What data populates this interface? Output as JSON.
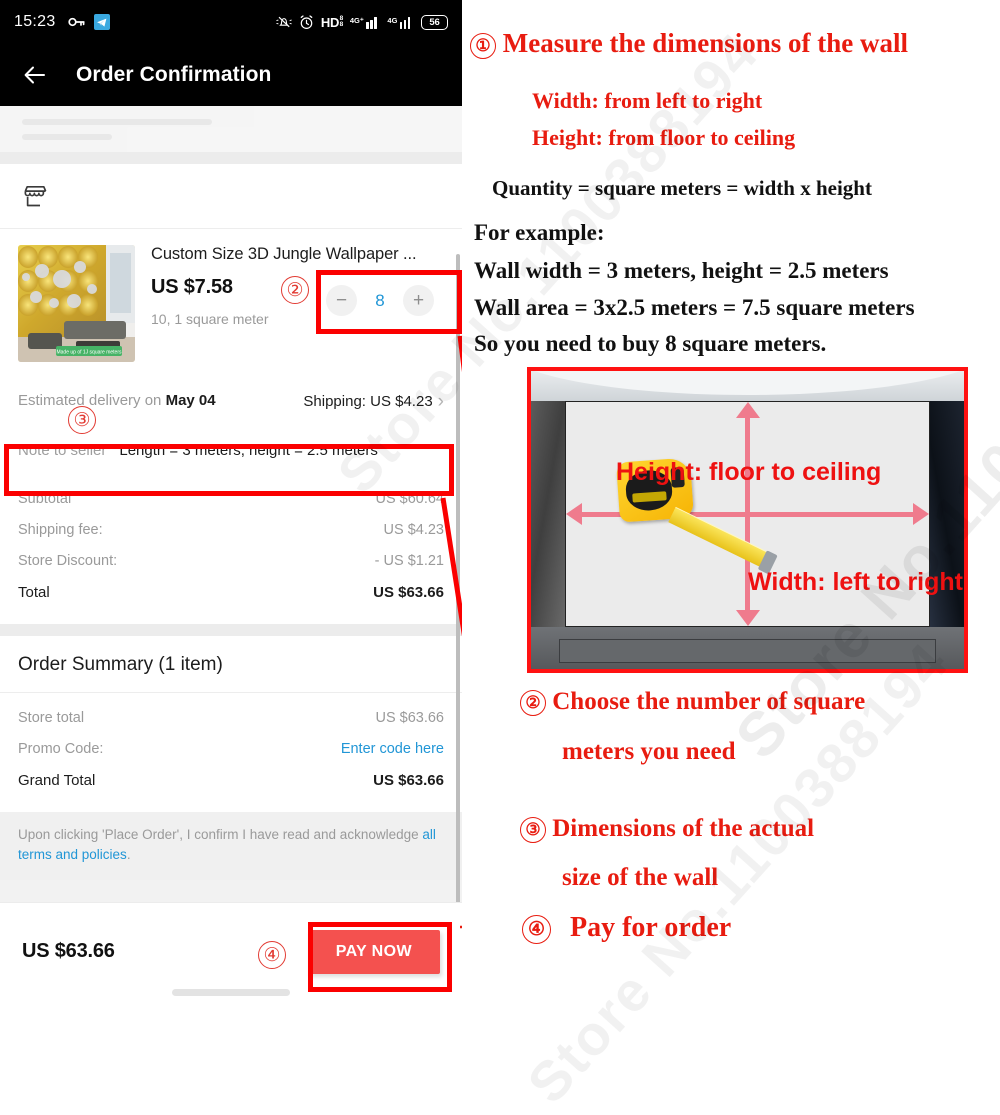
{
  "phone": {
    "statusbar": {
      "time": "15:23",
      "icons": [
        "key-icon",
        "telegram-icon",
        "silent-bell-icon",
        "alarm-clock-icon",
        "hd-icon",
        "signal-4g-plus-icon",
        "signal-4g-icon"
      ],
      "battery": "56"
    },
    "appbar": {
      "back_icon": "back-arrow-icon",
      "title": "Order Confirmation"
    },
    "store": {
      "icon": "storefront-icon",
      "name": ""
    },
    "product": {
      "title": "Custom Size 3D Jungle Wallpaper ...",
      "price": "US $7.58",
      "variant": "10, 1 square meter",
      "qty": "8",
      "minus": "−",
      "plus": "+",
      "thumb_badge": "Made up of 1J square meters"
    },
    "delivery": {
      "prefix": "Estimated delivery on ",
      "date": "May 04",
      "shipping_label": "Shipping: US $4.23",
      "chevron": "›"
    },
    "note": {
      "label": "Note to seller",
      "value": "Length = 3 meters, height = 2.5 meters"
    },
    "totals": [
      {
        "label": "Subtotal",
        "value": "US $60.64",
        "strong": false
      },
      {
        "label": "Shipping fee:",
        "value": "US $4.23",
        "strong": false
      },
      {
        "label": "Store Discount:",
        "value": "- US $1.21",
        "strong": false
      },
      {
        "label": "Total",
        "value": "US $63.66",
        "strong": true
      }
    ],
    "summary": {
      "heading": "Order Summary (1 item)",
      "rows": [
        {
          "label": "Store total",
          "value": "US $63.66",
          "strong": false,
          "link": false
        },
        {
          "label": "Promo Code:",
          "value": "Enter code here",
          "strong": false,
          "link": true
        },
        {
          "label": "Grand Total",
          "value": "US $63.66",
          "strong": true,
          "link": false
        }
      ]
    },
    "terms": {
      "text_before": "Upon clicking 'Place Order', I confirm I have read and acknowledge ",
      "link": "all terms and policies",
      "text_after": "."
    },
    "bottom": {
      "grand_total": "US $63.66",
      "pay_button": "PAY NOW"
    }
  },
  "annotations": {
    "markers": {
      "one": "①",
      "two": "②",
      "three": "③",
      "four": "④"
    },
    "step1": {
      "num": "①",
      "title": "Measure the dimensions of the wall",
      "line_width": "Width: from left to right",
      "line_height": "Height: from floor to ceiling"
    },
    "formula": "Quantity = square meters = width x height",
    "example": {
      "heading": "For example:",
      "l1": "Wall width = 3 meters, height = 2.5 meters",
      "l2": "Wall area = 3x2.5 meters = 7.5 square meters",
      "l3": "So you need to buy 8 square meters."
    },
    "wall_photo": {
      "height_label": "Height: floor to ceiling",
      "width_label": "Width: left to right"
    },
    "step2": {
      "num": "②",
      "l1": "Choose the number of square",
      "l2": "meters you need"
    },
    "step3": {
      "num": "③",
      "l1": "Dimensions of the actual",
      "l2": "size of the wall"
    },
    "step4": {
      "num": "④",
      "text": "Pay for order"
    }
  },
  "watermark": {
    "text": "Store No.1100388194"
  },
  "colors": {
    "annotation_red": "#e81c10",
    "box_red": "#fb0000",
    "pay_button": "#f4514f",
    "link_blue": "#2196d6",
    "arrow_pink": "#ef7b8d"
  }
}
